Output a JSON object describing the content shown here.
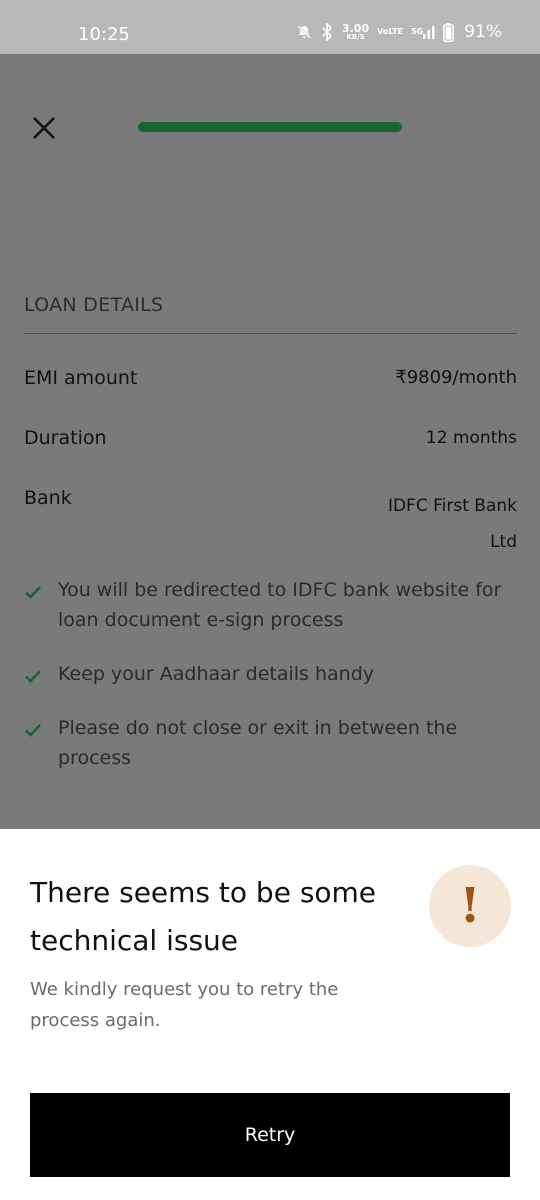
{
  "status_bar": {
    "time": "10:25",
    "net_speed_value": "3.00",
    "net_speed_unit": "KB/S",
    "volte_top": "Vo",
    "volte_bottom": "LTE",
    "network_type": "5G",
    "battery_percent": "91%",
    "icons": [
      "mute-bell-icon",
      "bluetooth-icon",
      "signal-icon",
      "battery-icon"
    ]
  },
  "header": {
    "close_icon": "close-icon",
    "progress_fraction": 1.0,
    "progress_color": "#17652f"
  },
  "loan_details": {
    "section_title": "LOAN DETAILS",
    "rows": [
      {
        "label": "EMI amount",
        "value": "₹9809/month"
      },
      {
        "label": "Duration",
        "value": "12 months"
      },
      {
        "label": "Bank",
        "value": "IDFC First Bank Ltd"
      }
    ]
  },
  "checklist": {
    "icon": "checkmark-icon",
    "icon_color": "#17652f",
    "items": [
      "You will be redirected to IDFC bank website for loan document e-sign process",
      "Keep your Aadhaar details handy",
      "Please do not close or exit in between the process"
    ]
  },
  "error_sheet": {
    "title": "There seems to be some technical issue",
    "alert_icon": "exclamation-icon",
    "alert_symbol": "!",
    "alert_color": "#9c5317",
    "message": "We kindly request you to retry the process again.",
    "retry_label": "Retry"
  }
}
